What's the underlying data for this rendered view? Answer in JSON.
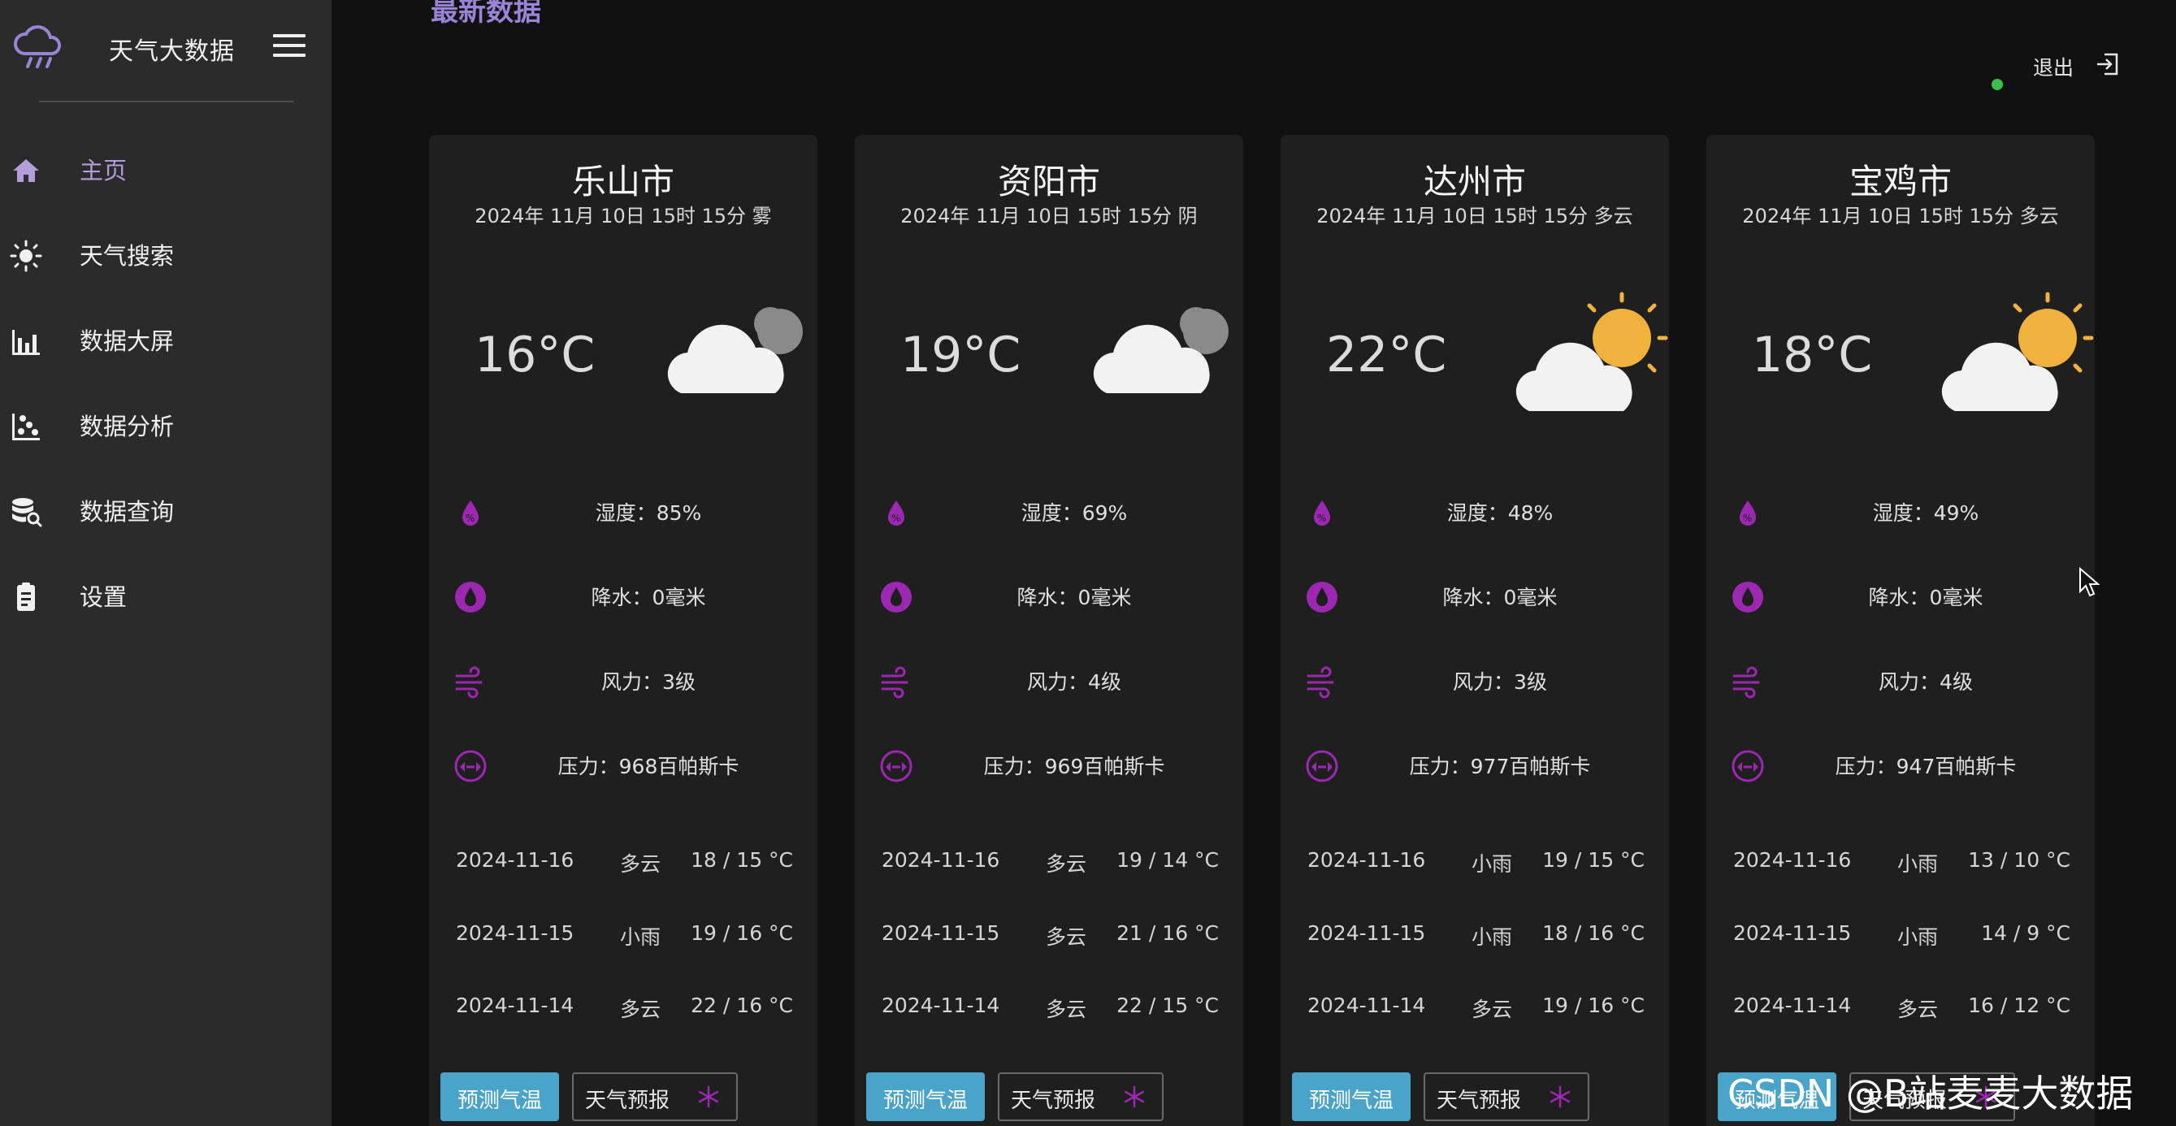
{
  "app": {
    "title": "天气大数据",
    "menu_toggle_icon": "hamburger-icon",
    "logo_icon": "cloud-rain-icon"
  },
  "sidebar": {
    "items": [
      {
        "label": "主页",
        "icon": "home-icon",
        "active": true
      },
      {
        "label": "天气搜索",
        "icon": "sun-icon",
        "active": false
      },
      {
        "label": "数据大屏",
        "icon": "bar-chart-icon",
        "active": false
      },
      {
        "label": "数据分析",
        "icon": "scatter-icon",
        "active": false
      },
      {
        "label": "数据查询",
        "icon": "database-search-icon",
        "active": false
      },
      {
        "label": "设置",
        "icon": "settings-clipboard-icon",
        "active": false
      }
    ]
  },
  "header": {
    "section_title": "最新数据",
    "logout_label": "退出",
    "status_color": "#3bbf4a"
  },
  "cards": [
    {
      "city": "乐山市",
      "datetime": "2024年 11月 10日 15时 15分 雾",
      "temp": "16°C",
      "weather_icon": "cloud-overcast-icon",
      "humidity": "湿度：85%",
      "rain": "降水：0毫米",
      "wind": "风力：3级",
      "pressure": "压力：968百帕斯卡",
      "forecast": [
        {
          "date": "2024-11-16",
          "weather": "多云",
          "temp": "18 / 15 °C"
        },
        {
          "date": "2024-11-15",
          "weather": "小雨",
          "temp": "19 / 16 °C"
        },
        {
          "date": "2024-11-14",
          "weather": "多云",
          "temp": "22 / 16 °C"
        }
      ],
      "btn_primary": "预测气温",
      "btn_secondary": "天气预报"
    },
    {
      "city": "资阳市",
      "datetime": "2024年 11月 10日 15时 15分 阴",
      "temp": "19°C",
      "weather_icon": "cloud-overcast-icon",
      "humidity": "湿度：69%",
      "rain": "降水：0毫米",
      "wind": "风力：4级",
      "pressure": "压力：969百帕斯卡",
      "forecast": [
        {
          "date": "2024-11-16",
          "weather": "多云",
          "temp": "19 / 14 °C"
        },
        {
          "date": "2024-11-15",
          "weather": "多云",
          "temp": "21 / 16 °C"
        },
        {
          "date": "2024-11-14",
          "weather": "多云",
          "temp": "22 / 15 °C"
        }
      ],
      "btn_primary": "预测气温",
      "btn_secondary": "天气预报"
    },
    {
      "city": "达州市",
      "datetime": "2024年 11月 10日 15时 15分 多云",
      "temp": "22°C",
      "weather_icon": "partly-cloudy-icon",
      "humidity": "湿度：48%",
      "rain": "降水：0毫米",
      "wind": "风力：3级",
      "pressure": "压力：977百帕斯卡",
      "forecast": [
        {
          "date": "2024-11-16",
          "weather": "小雨",
          "temp": "19 / 15 °C"
        },
        {
          "date": "2024-11-15",
          "weather": "小雨",
          "temp": "18 / 16 °C"
        },
        {
          "date": "2024-11-14",
          "weather": "多云",
          "temp": "19 / 16 °C"
        }
      ],
      "btn_primary": "预测气温",
      "btn_secondary": "天气预报"
    },
    {
      "city": "宝鸡市",
      "datetime": "2024年 11月 10日 15时 15分 多云",
      "temp": "18°C",
      "weather_icon": "partly-cloudy-icon",
      "humidity": "湿度：49%",
      "rain": "降水：0毫米",
      "wind": "风力：4级",
      "pressure": "压力：947百帕斯卡",
      "forecast": [
        {
          "date": "2024-11-16",
          "weather": "小雨",
          "temp": "13 / 10 °C"
        },
        {
          "date": "2024-11-15",
          "weather": "小雨",
          "temp": "14 / 9 °C"
        },
        {
          "date": "2024-11-14",
          "weather": "多云",
          "temp": "16 / 12 °C"
        }
      ],
      "btn_primary": "预测气温",
      "btn_secondary": "天气预报"
    }
  ],
  "overlay": {
    "watermark": "CSDN @B站麦麦大数据"
  },
  "colors": {
    "accent_purple": "#9c27b0",
    "primary_button": "#4aa3c8",
    "active_nav": "#b39ddb"
  }
}
